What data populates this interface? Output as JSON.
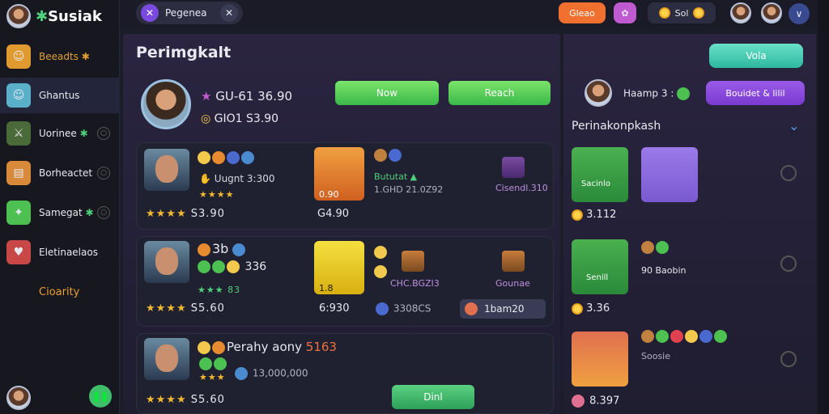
{
  "app": {
    "brand": "Susiak",
    "brand_mark": "✱"
  },
  "sidebar": {
    "items": [
      {
        "label": "Beeadts",
        "suffix": "✱",
        "color": "#e0a030"
      },
      {
        "label": "Ghantus",
        "color": "#e8e8f0"
      },
      {
        "label": "Uorinee",
        "suffix": "✱",
        "color": "#e8e8f0"
      },
      {
        "label": "Borheactet",
        "color": "#e8e8f0"
      },
      {
        "label": "Samegat",
        "suffix": "✱",
        "color": "#e8e8f0"
      },
      {
        "label": "Eletinaelaos",
        "color": "#e8e8f0"
      }
    ],
    "cta": "Cioarity"
  },
  "topbar": {
    "tab_label": "Pegenea",
    "action_orange": "Gleao",
    "currency_value": "Sol"
  },
  "main": {
    "title": "Perimgkalt",
    "profile": {
      "stat1": "GU-61 36.90",
      "stat2": "GIO1 S3.90",
      "btn1": "Now",
      "btn2": "Reach"
    },
    "rows": [
      {
        "label": "Uugnt 3:300",
        "rating": "S3.90",
        "tile_value": "0.90",
        "sub": "Bututat ▲",
        "sub2": "1.GHD 21.0Z92",
        "chest_label": "Cisendl.310",
        "price": "G4.90"
      },
      {
        "header": "3b",
        "header_val": "336",
        "stars_val": "83",
        "rating": "S5.60",
        "price": "6:930",
        "mid_label": "CHC.BGZI3",
        "chest_label": "Gounae",
        "mid_val": "3308CS",
        "panel_val": "1bam20",
        "tile_value": "1.8"
      },
      {
        "title": "Perahy aony",
        "title_val": "5163",
        "sub": "13,000,000",
        "rating": "S5.60",
        "btn": "Dinl"
      }
    ]
  },
  "right": {
    "btn_top": "Vola",
    "chip_label": "Haamp",
    "chip_value": "3 :",
    "purple_btn": "Bouidet & lilil",
    "section": "Perinakonpkash",
    "rows": [
      {
        "tile_label": "Sacinlo",
        "val": "3.112"
      },
      {
        "tile_label": "Senill",
        "val": "3.36",
        "side": "90 Baobin"
      },
      {
        "tile_label": "",
        "val": "8.397",
        "side": "Soosie"
      }
    ]
  }
}
